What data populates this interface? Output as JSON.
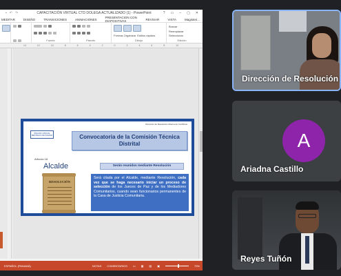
{
  "ppt": {
    "window_title": "CAPACITACIÓN VIRTUAL CTD DOLEGA ACTUALIZADO (1) - PowerPoint",
    "window_buttons": [
      "?",
      "▭",
      "–",
      "▢",
      "✕"
    ],
    "tabs": [
      "MEDITAR",
      "DISEÑO",
      "TRANSICIONES",
      "ANIMACIONES",
      "PRESENTACIÓN CON DIAPOSITIVAS",
      "REVISAR",
      "VISTA"
    ],
    "user": "Magisteri...",
    "ribbon": {
      "group_labels": [
        "Fuente",
        "Párrafo",
        "Dibujo",
        "Edición"
      ],
      "format_label": "Formas Organizar",
      "styles_label": "Estilos rápidos",
      "edit_items": [
        "Buscar",
        "Reemplazar",
        "Seleccionar"
      ]
    },
    "ruler_ticks": [
      "14",
      "12",
      "10",
      "8",
      "6",
      "4",
      "2",
      "0",
      "2",
      "4",
      "6",
      "8",
      "10"
    ],
    "slide": {
      "header_small": "Dirección de Resolución Alterna de Conflictos",
      "logo_text": "ÓRGANO JUDICIAL REPÚBLICA DE PANAMÁ",
      "title": "Convocatoria de la Comisión Técnica Distrital",
      "article": "Artículo 18",
      "alcalde": "Alcalde",
      "subtitle": "Serán reunidos mediante Resolución",
      "scroll_title": "RESOLUCIÓN",
      "body_start": "Será citada por el Alcalde, mediante Resolución, ",
      "body_bold": "cada vez que se haga necesario iniciar un proceso de selección",
      "body_end": " de los Jueces de Paz y de los Mediadores Comunitarios, cuando sean funcionarios permanentes de la Casa de Justicia Comunitaria."
    },
    "status": {
      "left": "ESPAÑOL (PANAMÁ)",
      "notes": "NOTAS",
      "comments": "COMENTARIOS",
      "zoom": "79%"
    },
    "accent_color": "#c7472b"
  },
  "participants": [
    {
      "name": "Dirección de Resolución A",
      "type": "video",
      "active_speaker": true
    },
    {
      "name": "Ariadna Castillo",
      "type": "avatar",
      "initial": "A",
      "avatar_color": "#8e24aa"
    },
    {
      "name": "Reyes Tuñón",
      "type": "video"
    }
  ]
}
